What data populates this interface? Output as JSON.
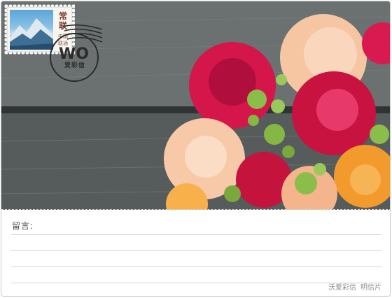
{
  "card": {
    "message_label": "留言:",
    "footer_brand": "沃爱彩信",
    "footer_kind": "明信片"
  },
  "stamp": {
    "title_chars": [
      "常",
      "联"
    ],
    "subtitle": "中国联通"
  },
  "postmark": {
    "logo": "WO",
    "text": "爱彩信"
  },
  "colors": {
    "rose_red": "#d4164b",
    "rose_peach": "#f6c6a3",
    "rose_orange": "#f39a2c",
    "bud_green": "#8bbd4a",
    "wood_gray": "#5b615f",
    "line_gray": "#d4d4d4"
  }
}
